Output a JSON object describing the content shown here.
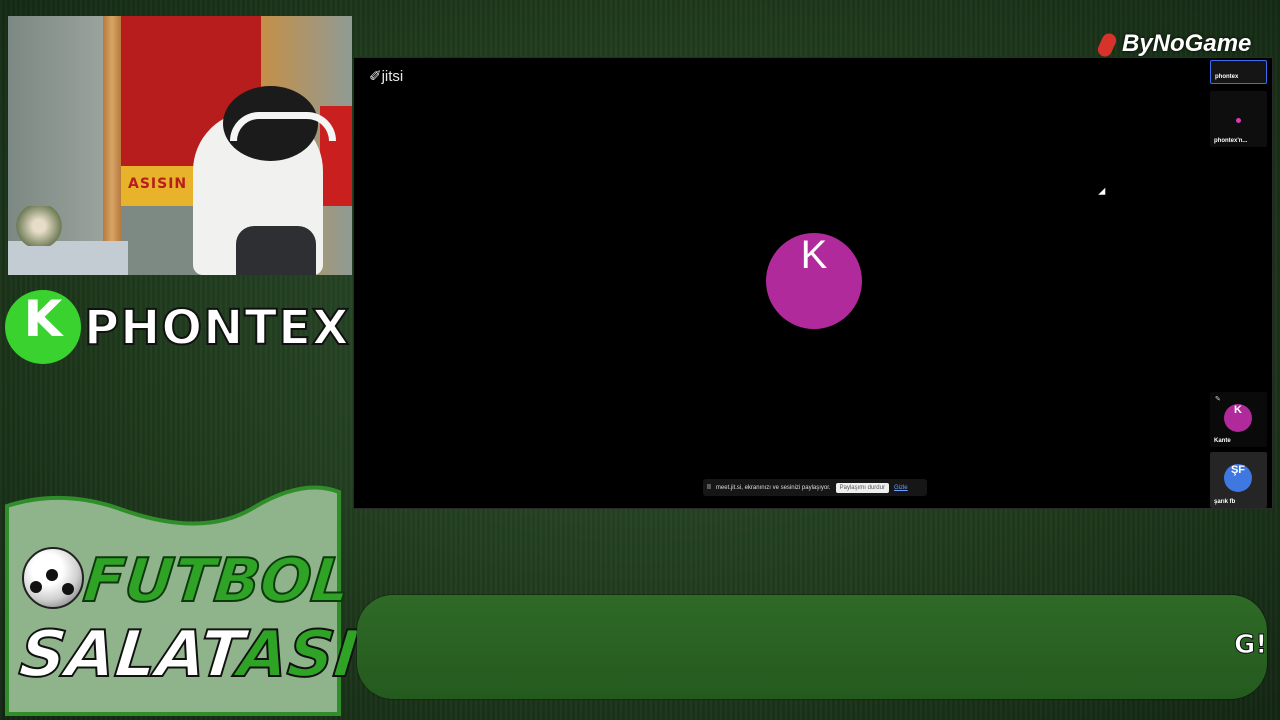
{
  "brand": {
    "name": "ByNoGame"
  },
  "webcam": {
    "flag_text": "ASISIN"
  },
  "streamer": {
    "channel_name": "PHONTEX",
    "platform_letter": "K"
  },
  "show": {
    "title_line1": "FUTBOL",
    "title_line2a": "SALAT",
    "title_line2b": "ASI"
  },
  "jitsi": {
    "logo_label": "jitsi",
    "main_avatar_letter": "K",
    "share_bar": {
      "pause_icon": "II",
      "message": "meet.jit.si, ekranınızı ve sesinizi paylaşıyor.",
      "stop_button": "Paylaşımı durdur",
      "hide_link": "Gizle"
    },
    "filmstrip": [
      {
        "label": "phontex"
      },
      {
        "label": "phontex'n..."
      },
      {
        "label": "Kante",
        "avatar": "K",
        "color": "#b02a9c"
      },
      {
        "label": "şarık fb",
        "avatar": "ŞF",
        "color": "#3f78e0"
      }
    ]
  },
  "ticker": {
    "text": "G!"
  },
  "colors": {
    "kick_green": "#39d22f",
    "avatar_magenta": "#b02a9c",
    "avatar_blue": "#3f78e0",
    "grass": "#2f4f2c"
  }
}
